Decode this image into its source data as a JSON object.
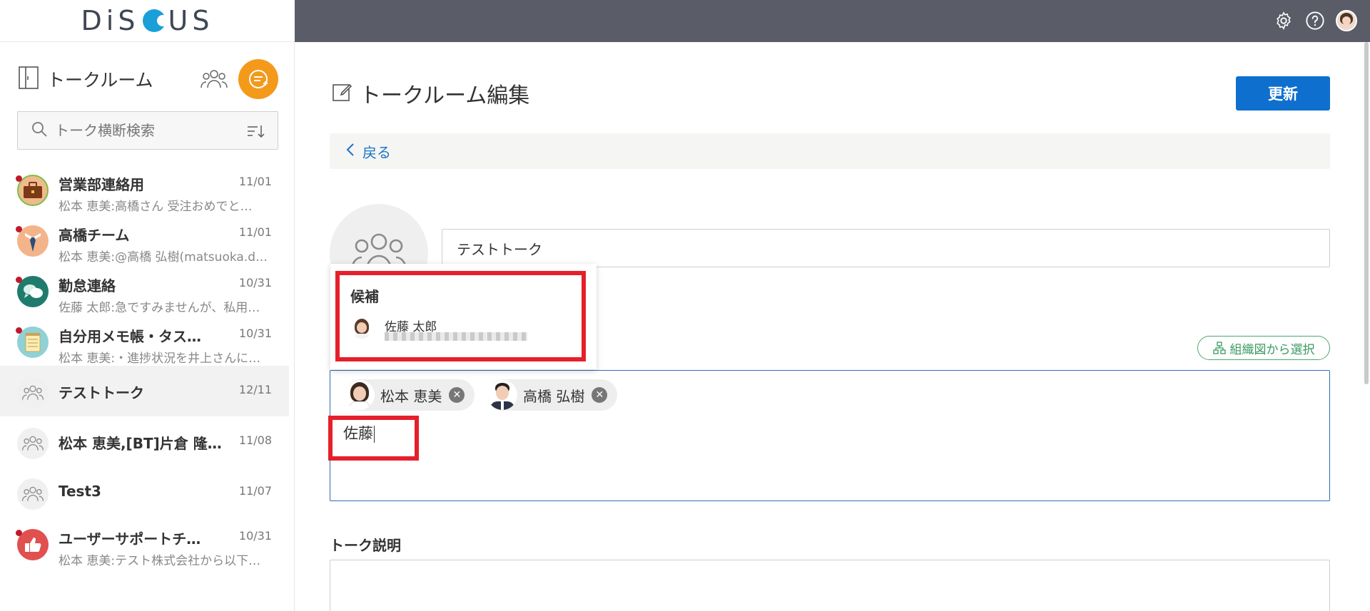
{
  "header": {
    "brand": "DiSCUS",
    "icons": [
      "gear-icon",
      "help-icon",
      "user-avatar"
    ]
  },
  "sidebar": {
    "title": "トークルーム",
    "search_placeholder": "トーク横断検索",
    "rooms": [
      {
        "name": "営業部連絡用",
        "date": "11/01",
        "preview": "松本 恵美:高橋さん 受注おめでと…",
        "unread": true,
        "avatar": "briefcase"
      },
      {
        "name": "高橋チーム",
        "date": "11/01",
        "preview": "松本 恵美:@高橋 弘樹(matsuoka.d…",
        "unread": true,
        "avatar": "tie"
      },
      {
        "name": "勤怠連絡",
        "date": "10/31",
        "preview": "佐藤 太郎:急ですみませんが、私用…",
        "unread": true,
        "avatar": "chat"
      },
      {
        "name": "自分用メモ帳・タス…",
        "date": "10/31",
        "preview": "松本 恵美:・進捗状況を井上さんに…",
        "unread": true,
        "avatar": "memo"
      },
      {
        "name": "テストトーク",
        "date": "12/11",
        "preview": "",
        "unread": false,
        "avatar": "group",
        "active": true
      },
      {
        "name": "松本 恵美,[BT]片倉 隆…",
        "date": "11/08",
        "preview": "",
        "unread": false,
        "avatar": "group"
      },
      {
        "name": "Test3",
        "date": "11/07",
        "preview": "",
        "unread": false,
        "avatar": "group"
      },
      {
        "name": "ユーザーサポートチ…",
        "date": "10/31",
        "preview": "松本 恵美:テスト株式会社から以下…",
        "unread": true,
        "avatar": "thumb"
      }
    ]
  },
  "main": {
    "page_title": "トークルーム編集",
    "update_label": "更新",
    "back_label": "戻る",
    "room_name": "テストトーク",
    "org_select_label": "組織図から選択",
    "members": [
      "松本 恵美",
      "高橋 弘樹"
    ],
    "member_input": "佐藤",
    "description_label": "トーク説明",
    "suggestion": {
      "label": "候補",
      "name": "佐藤 太郎"
    }
  },
  "colors": {
    "accent": "#0e6fcf",
    "new_button": "#f39a1b",
    "header_dark": "#5a5d68",
    "highlight": "#e5202a",
    "org_green": "#3b9a5f"
  }
}
